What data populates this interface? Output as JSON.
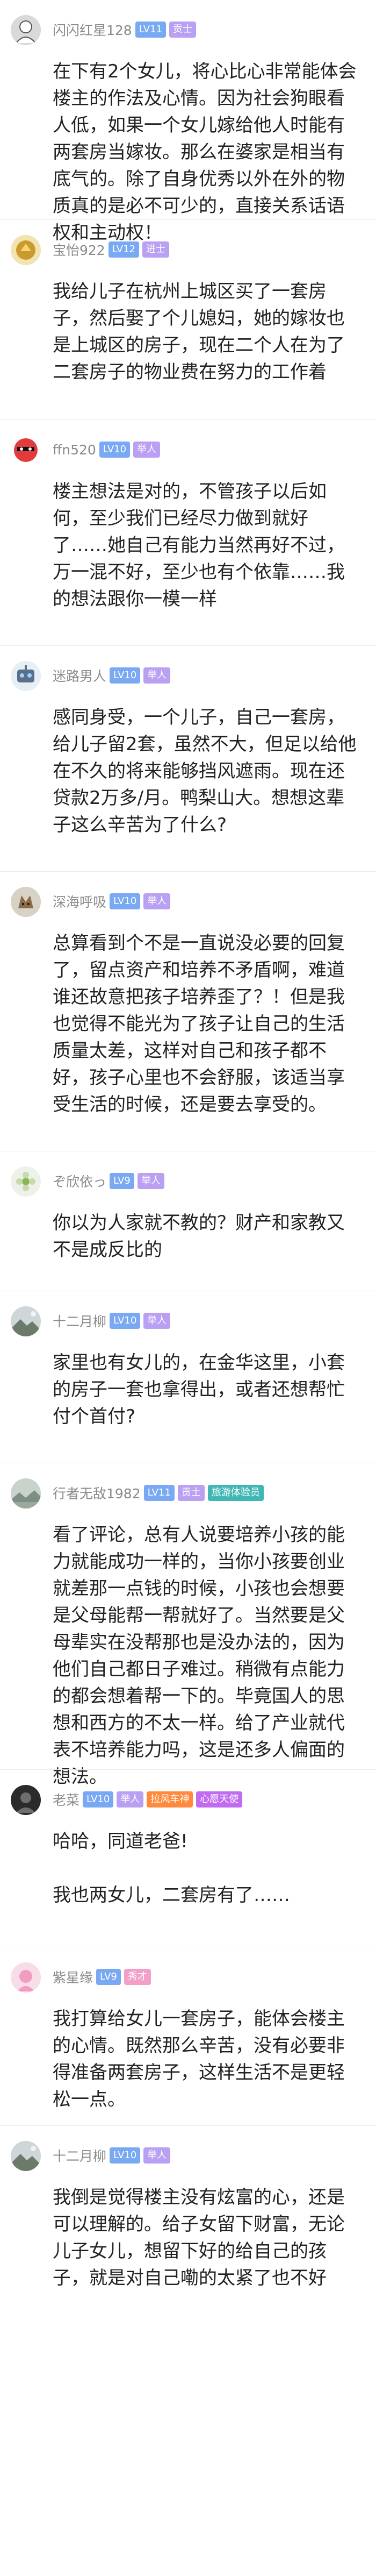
{
  "comments": [
    {
      "username": "闪闪红星128",
      "level": "LV11",
      "title": "贡士",
      "avatar": "avatar-sketch-icon",
      "text": "在下有2个女儿，将心比心非常能体会楼主的作法及心情。因为社会狗眼看人低，如果一个女儿嫁给他人时能有两套房当嫁妆。那么在婆家是相当有底气的。除了自身优秀以外在外的物质真的是必不可少的，直接关系话语权和主动权！"
    },
    {
      "username": "宝怡922",
      "level": "LV12",
      "title": "进士",
      "avatar": "avatar-gold-icon",
      "text": "我给儿子在杭州上城区买了一套房子，然后娶了个儿媳妇，她的嫁妆也是上城区的房子，现在二个人在为了二套房子的物业费在努力的工作着"
    },
    {
      "username": "ffn520",
      "level": "LV10",
      "title": "举人",
      "avatar": "avatar-red-face-icon",
      "text": "楼主想法是对的，不管孩子以后如何，至少我们已经尽力做到就好了……她自己有能力当然再好不过，万一混不好，至少也有个依靠……我的想法跟你一模一样"
    },
    {
      "username": "迷路男人",
      "level": "LV10",
      "title": "举人",
      "avatar": "avatar-robot-icon",
      "text": "感同身受，一个儿子，自己一套房，给儿子留2套，虽然不大，但足以给他在不久的将来能够挡风遮雨。现在还贷款2万多/月。鸭梨山大。想想这辈子这么辛苦为了什么?"
    },
    {
      "username": "深海呼吸",
      "level": "LV10",
      "title": "举人",
      "avatar": "avatar-fox-icon",
      "text": "总算看到个不是一直说没必要的回复了，留点资产和培养不矛盾啊，难道谁还故意把孩子培养歪了？！但是我也觉得不能光为了孩子让自己的生活质量太差，这样对自己和孩子都不好，孩子心里也不会舒服，该适当享受生活的时候，还是要去享受的。"
    },
    {
      "username": "ぞ欣依っ",
      "level": "LV9",
      "title": "举人",
      "avatar": "avatar-flower-icon",
      "text": "你以为人家就不教的？财产和家教又不是成反比的"
    },
    {
      "username": "十二月柳",
      "level": "LV10",
      "title": "举人",
      "avatar": "avatar-landscape-icon",
      "text": "家里也有女儿的，在金华这里，小套的房子一套也拿得出，或者还想帮忙付个首付?"
    },
    {
      "username": "行者无敌1982",
      "level": "LV11",
      "title": "贡士",
      "extra_badge": "旅游体验员",
      "avatar": "avatar-scenery-icon",
      "text": "看了评论，总有人说要培养小孩的能力就能成功一样的，当你小孩要创业就差那一点钱的时候，小孩也会想要是父母能帮一帮就好了。当然要是父母辈实在没帮那也是没办法的，因为他们自己都日子难过。稍微有点能力的都会想着帮一下的。毕竟国人的思想和西方的不太一样。给了产业就代表不培养能力吗，这是还多人偏面的想法。"
    },
    {
      "username": "老菜",
      "level": "LV10",
      "title": "举人",
      "extra_badge": "拉风车神",
      "extra_badge_2": "心愿天使",
      "avatar": "avatar-dark-icon",
      "text": "哈哈，同道老爸!\n\n我也两女儿，二套房有了……"
    },
    {
      "username": "紫星缘",
      "level": "LV9",
      "title": "秀才",
      "avatar": "avatar-pink-icon",
      "text": "我打算给女儿一套房子，能体会楼主的心情。既然那么辛苦，没有必要非得准备两套房子，这样生活不是更轻松一点。"
    },
    {
      "username": "十二月柳",
      "level": "LV10",
      "title": "举人",
      "avatar": "avatar-landscape-icon",
      "text": "我倒是觉得楼主没有炫富的心，还是可以理解的。给子女留下财富，无论儿子女儿，想留下好的给自己的孩子，就是对自己嘞的太紧了也不好"
    }
  ]
}
